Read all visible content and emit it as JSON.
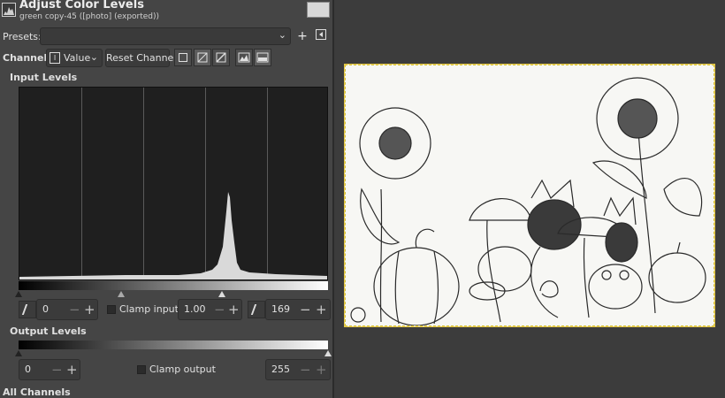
{
  "dialog": {
    "title": "Adjust Color Levels",
    "subtitle": "green copy-45 ([photo] (exported))",
    "icon": "levels-icon"
  },
  "presets": {
    "label": "Presets:",
    "value": "",
    "add_icon": "plus-icon",
    "manage_icon": "menu-left-icon"
  },
  "channel": {
    "label": "Channel:",
    "value": "Value",
    "value_icon": "value-channel-icon",
    "reset_label": "Reset Channel",
    "toggles": [
      "linear-histogram-icon",
      "log-histogram-icon",
      "perceptual-icon",
      "histogram-view-icon",
      "histogram-alt-icon"
    ]
  },
  "input_levels": {
    "label": "Input Levels",
    "low": "0",
    "gamma": "1.00",
    "high": "169",
    "clamp_label": "Clamp input",
    "clamp_checked": false
  },
  "histogram": {
    "peak_fraction": 0.69,
    "peak_position": 0.69
  },
  "output_levels": {
    "label": "Output Levels",
    "low": "0",
    "high": "255",
    "clamp_label": "Clamp output",
    "clamp_checked": false
  },
  "section_all_channels": "All Channels",
  "colors": {
    "panel_bg": "#454545",
    "canvas_bg": "#3c3c3c",
    "selection": "#e6c84a"
  }
}
